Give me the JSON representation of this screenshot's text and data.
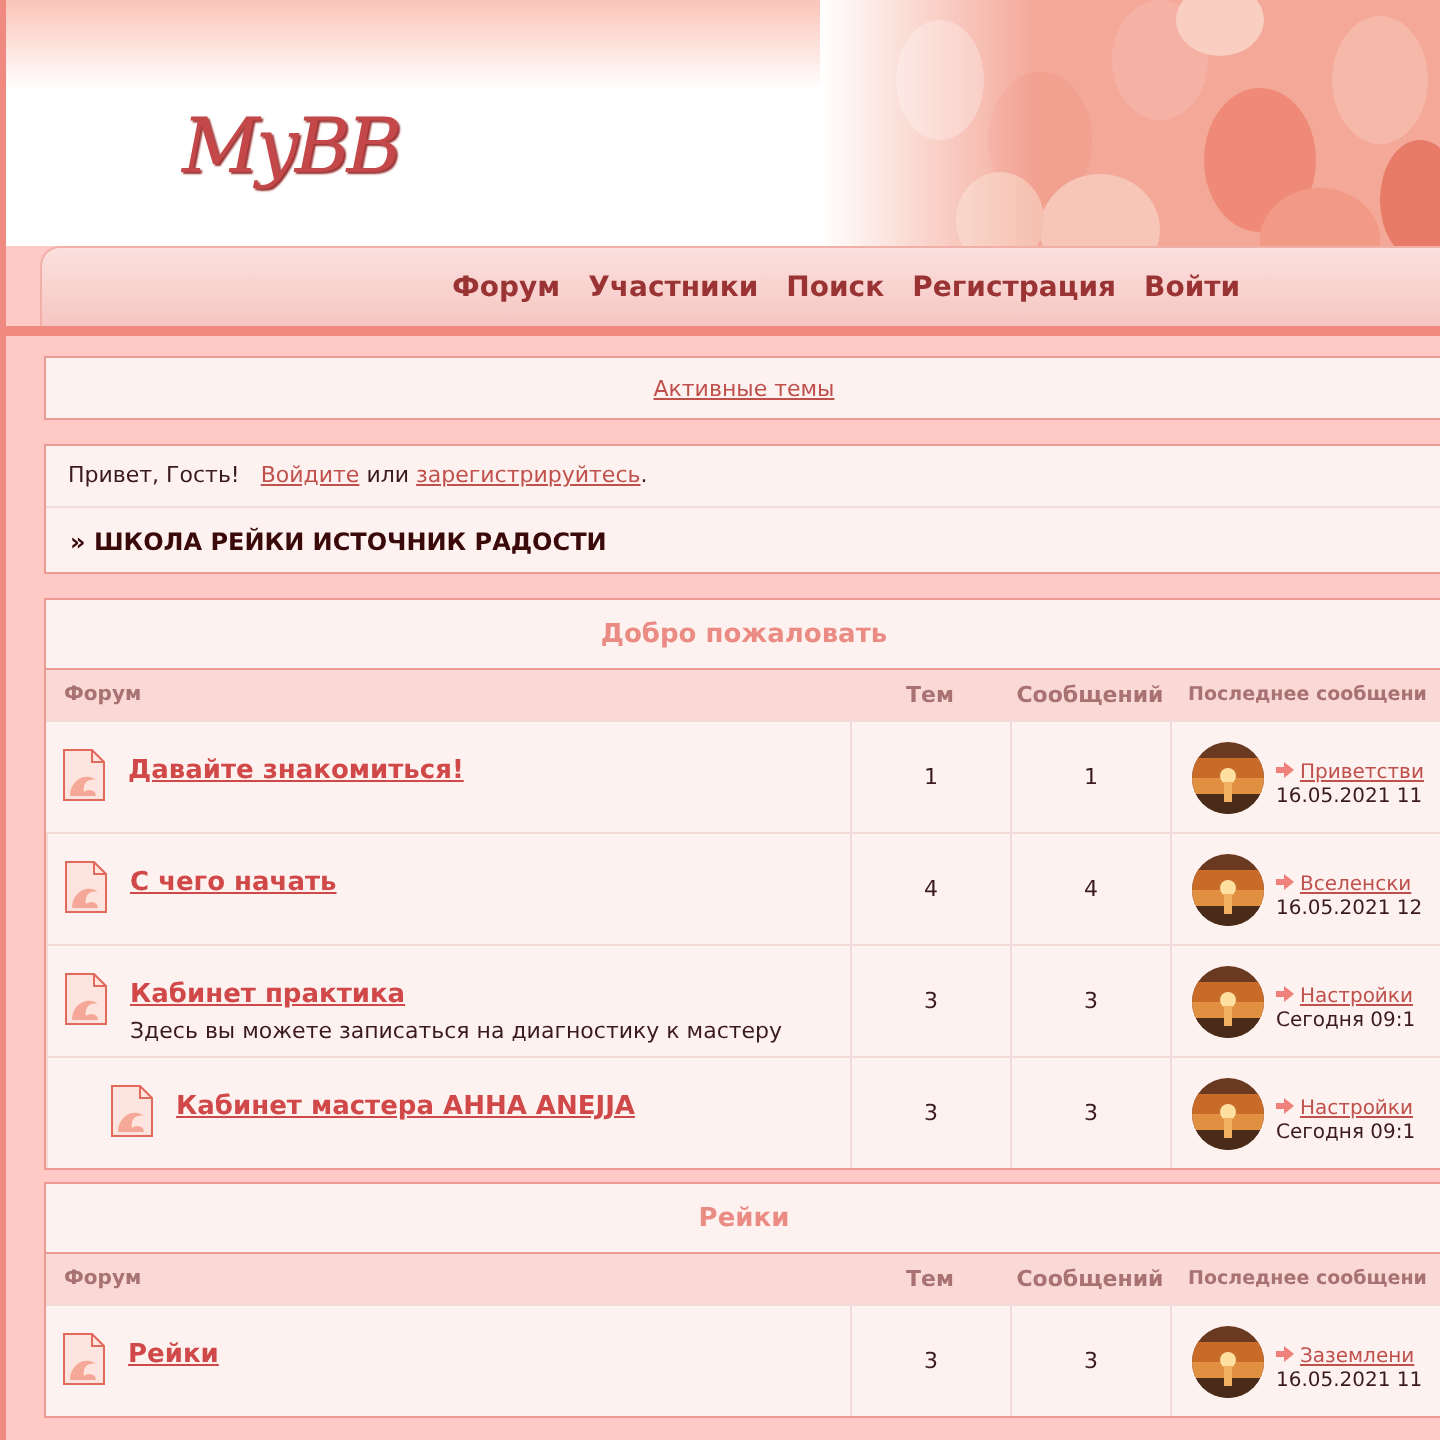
{
  "header": {
    "logo": "MyBB"
  },
  "nav": [
    "Форум",
    "Участники",
    "Поиск",
    "Регистрация",
    "Войти"
  ],
  "links_box": {
    "link": "Активные темы"
  },
  "welcome": {
    "greeting": "Привет, Гость!",
    "login_link": "Войдите",
    "or": "или",
    "register_link": "зарегистрируйтесь",
    "end": "."
  },
  "breadcrumb": {
    "mark": "»",
    "title": "ШКОЛА РЕЙКИ ИСТОЧНИК РАДОСТИ"
  },
  "categories": [
    {
      "title": "Добро пожаловать",
      "columns": [
        "Форум",
        "Тем",
        "Сообщений",
        "Последнее сообщени"
      ],
      "forums": [
        {
          "name": "Давайте знакомиться!",
          "topics": "1",
          "posts": "1",
          "last_post": {
            "title": "Приветстви",
            "date": "16.05.2021 11"
          }
        },
        {
          "name": "С чего начать",
          "topics": "4",
          "posts": "4",
          "last_post": {
            "title": "Вселенски",
            "date": "16.05.2021 12"
          }
        },
        {
          "name": "Кабинет практика",
          "description": "Здесь вы можете записаться на диагностику к мастеру",
          "topics": "3",
          "posts": "3",
          "last_post": {
            "title": "Настройки",
            "date": "Сегодня 09:1"
          },
          "children": [
            {
              "name": "Кабинет мастера АННА ANEJJA",
              "topics": "3",
              "posts": "3",
              "last_post": {
                "title": "Настройки",
                "date": "Сегодня 09:1"
              }
            }
          ]
        }
      ]
    },
    {
      "title": "Рейки",
      "columns": [
        "Форум",
        "Тем",
        "Сообщений",
        "Последнее сообщени"
      ],
      "forums": [
        {
          "name": "Рейки",
          "topics": "3",
          "posts": "3",
          "last_post": {
            "title": "Заземлени",
            "date": "16.05.2021 11"
          }
        }
      ]
    }
  ]
}
